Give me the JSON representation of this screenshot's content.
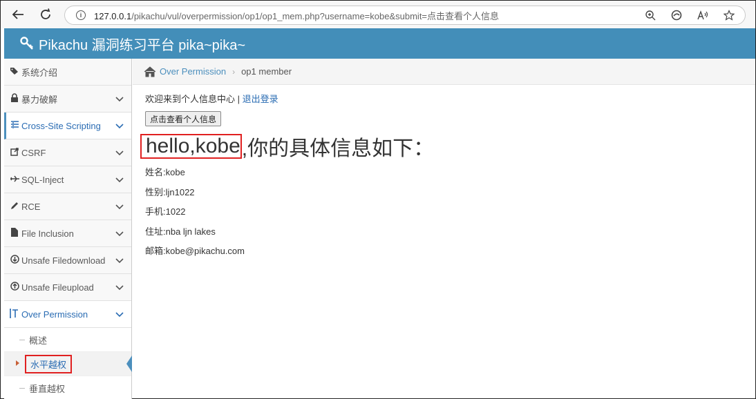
{
  "browser": {
    "url_host": "127.0.0.1",
    "url_path": "/pikachu/vul/overpermission/op1/op1_mem.php?username=kobe&submit=点击查看个人信息"
  },
  "header": {
    "title": "Pikachu 漏洞练习平台 pika~pika~"
  },
  "sidebar": {
    "items": [
      {
        "label": "系统介绍",
        "icon": "tag-icon"
      },
      {
        "label": "暴力破解",
        "icon": "lock-icon"
      },
      {
        "label": "Cross-Site Scripting",
        "icon": "list-icon"
      },
      {
        "label": "CSRF",
        "icon": "share-icon"
      },
      {
        "label": "SQL-Inject",
        "icon": "plane-icon"
      },
      {
        "label": "RCE",
        "icon": "pencil-icon"
      },
      {
        "label": "File Inclusion",
        "icon": "file-icon"
      },
      {
        "label": "Unsafe Filedownload",
        "icon": "download-icon"
      },
      {
        "label": "Unsafe Fileupload",
        "icon": "upload-icon"
      },
      {
        "label": "Over Permission",
        "icon": "text-height-icon"
      }
    ],
    "sub_items": [
      {
        "label": "概述"
      },
      {
        "label": "水平越权"
      },
      {
        "label": "垂直越权"
      }
    ]
  },
  "breadcrumb": {
    "link": "Over Permission",
    "current": "op1 member"
  },
  "main": {
    "welcome": "欢迎来到个人信息中心",
    "separator": " | ",
    "logout": "退出登录",
    "view_button": "点击查看个人信息",
    "hello": "hello,kobe",
    "title_rest": ",你的具体信息如下：",
    "name": "姓名:kobe",
    "sex": "性别:ljn1022",
    "phone": "手机:1022",
    "address": "住址:nba ljn lakes",
    "email": "邮箱:kobe@pikachu.com"
  },
  "colors": {
    "header": "#438eb9",
    "link": "#2a6cb3",
    "highlight": "#e02020"
  }
}
